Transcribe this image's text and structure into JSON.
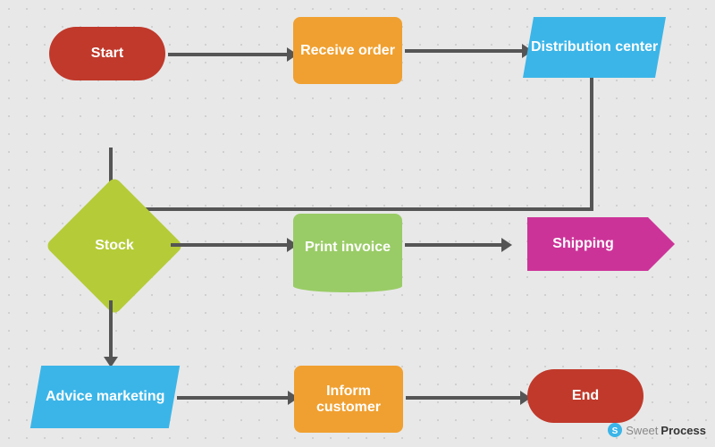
{
  "shapes": {
    "start": {
      "label": "Start",
      "color": "#c0392b"
    },
    "receive_order": {
      "label": "Receive order",
      "color": "#f0a030"
    },
    "distribution_center": {
      "label": "Distribution center",
      "color": "#3bb5e8"
    },
    "stock": {
      "label": "Stock",
      "color": "#b5cc38"
    },
    "print_invoice": {
      "label": "Print invoice",
      "color": "#99cc66"
    },
    "shipping": {
      "label": "Shipping",
      "color": "#cc3399"
    },
    "advice_marketing": {
      "label": "Advice marketing",
      "color": "#3bb5e8"
    },
    "inform_customer": {
      "label": "Inform customer",
      "color": "#f0a030"
    },
    "end": {
      "label": "End",
      "color": "#c0392b"
    }
  },
  "brand": {
    "sweet": "Sweet",
    "process": "Process"
  }
}
